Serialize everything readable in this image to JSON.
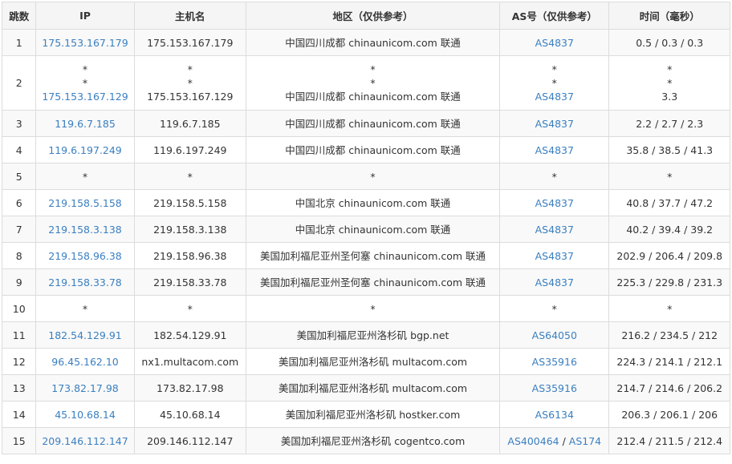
{
  "headers": [
    "跳数",
    "IP",
    "主机名",
    "地区（仅供参考）",
    "AS号（仅供参考）",
    "时间（毫秒）"
  ],
  "rows": [
    {
      "hop": "1",
      "ip": [
        "175.153.167.179"
      ],
      "host": [
        "175.153.167.179"
      ],
      "region": [
        "中国四川成都 chinaunicom.com 联通"
      ],
      "as": [
        [
          "AS4837"
        ]
      ],
      "time": [
        "0.5 / 0.3 / 0.3"
      ]
    },
    {
      "hop": "2",
      "ip": [
        "*",
        "*",
        "175.153.167.129"
      ],
      "host": [
        "*",
        "*",
        "175.153.167.129"
      ],
      "region": [
        "*",
        "*",
        "中国四川成都 chinaunicom.com 联通"
      ],
      "as": [
        [
          "*"
        ],
        [
          "*"
        ],
        [
          "AS4837"
        ]
      ],
      "time": [
        "*",
        "*",
        "3.3"
      ]
    },
    {
      "hop": "3",
      "ip": [
        "119.6.7.185"
      ],
      "host": [
        "119.6.7.185"
      ],
      "region": [
        "中国四川成都 chinaunicom.com 联通"
      ],
      "as": [
        [
          "AS4837"
        ]
      ],
      "time": [
        "2.2 / 2.7 / 2.3"
      ]
    },
    {
      "hop": "4",
      "ip": [
        "119.6.197.249"
      ],
      "host": [
        "119.6.197.249"
      ],
      "region": [
        "中国四川成都 chinaunicom.com 联通"
      ],
      "as": [
        [
          "AS4837"
        ]
      ],
      "time": [
        "35.8 / 38.5 / 41.3"
      ]
    },
    {
      "hop": "5",
      "ip": [
        "*"
      ],
      "host": [
        "*"
      ],
      "region": [
        "*"
      ],
      "as": [
        [
          "*"
        ]
      ],
      "time": [
        "*"
      ]
    },
    {
      "hop": "6",
      "ip": [
        "219.158.5.158"
      ],
      "host": [
        "219.158.5.158"
      ],
      "region": [
        "中国北京 chinaunicom.com 联通"
      ],
      "as": [
        [
          "AS4837"
        ]
      ],
      "time": [
        "40.8 / 37.7 / 47.2"
      ]
    },
    {
      "hop": "7",
      "ip": [
        "219.158.3.138"
      ],
      "host": [
        "219.158.3.138"
      ],
      "region": [
        "中国北京 chinaunicom.com 联通"
      ],
      "as": [
        [
          "AS4837"
        ]
      ],
      "time": [
        "40.2 / 39.4 / 39.2"
      ]
    },
    {
      "hop": "8",
      "ip": [
        "219.158.96.38"
      ],
      "host": [
        "219.158.96.38"
      ],
      "region": [
        "美国加利福尼亚州圣何塞 chinaunicom.com 联通"
      ],
      "as": [
        [
          "AS4837"
        ]
      ],
      "time": [
        "202.9 / 206.4 / 209.8"
      ]
    },
    {
      "hop": "9",
      "ip": [
        "219.158.33.78"
      ],
      "host": [
        "219.158.33.78"
      ],
      "region": [
        "美国加利福尼亚州圣何塞 chinaunicom.com 联通"
      ],
      "as": [
        [
          "AS4837"
        ]
      ],
      "time": [
        "225.3 / 229.8 / 231.3"
      ]
    },
    {
      "hop": "10",
      "ip": [
        "*"
      ],
      "host": [
        "*"
      ],
      "region": [
        "*"
      ],
      "as": [
        [
          "*"
        ]
      ],
      "time": [
        "*"
      ]
    },
    {
      "hop": "11",
      "ip": [
        "182.54.129.91"
      ],
      "host": [
        "182.54.129.91"
      ],
      "region": [
        "美国加利福尼亚州洛杉矶 bgp.net"
      ],
      "as": [
        [
          "AS64050"
        ]
      ],
      "time": [
        "216.2 / 234.5 / 212"
      ]
    },
    {
      "hop": "12",
      "ip": [
        "96.45.162.10"
      ],
      "host": [
        "nx1.multacom.com"
      ],
      "region": [
        "美国加利福尼亚州洛杉矶 multacom.com"
      ],
      "as": [
        [
          "AS35916"
        ]
      ],
      "time": [
        "224.3 / 214.1 / 212.1"
      ]
    },
    {
      "hop": "13",
      "ip": [
        "173.82.17.98"
      ],
      "host": [
        "173.82.17.98"
      ],
      "region": [
        "美国加利福尼亚州洛杉矶 multacom.com"
      ],
      "as": [
        [
          "AS35916"
        ]
      ],
      "time": [
        "214.7 / 214.6 / 206.2"
      ]
    },
    {
      "hop": "14",
      "ip": [
        "45.10.68.14"
      ],
      "host": [
        "45.10.68.14"
      ],
      "region": [
        "美国加利福尼亚州洛杉矶 hostker.com"
      ],
      "as": [
        [
          "AS6134"
        ]
      ],
      "time": [
        "206.3 / 206.1 / 206"
      ]
    },
    {
      "hop": "15",
      "ip": [
        "209.146.112.147"
      ],
      "host": [
        "209.146.112.147"
      ],
      "region": [
        "美国加利福尼亚州洛杉矶 cogentco.com"
      ],
      "as": [
        [
          "AS400464",
          "AS174"
        ]
      ],
      "time": [
        "212.4 / 211.5 / 212.4"
      ]
    }
  ],
  "colors": {
    "link": "#3a7fc0",
    "border": "#dcdcdc",
    "header_bg": "#f5f5f5",
    "stripe": "#f9f9f9"
  }
}
